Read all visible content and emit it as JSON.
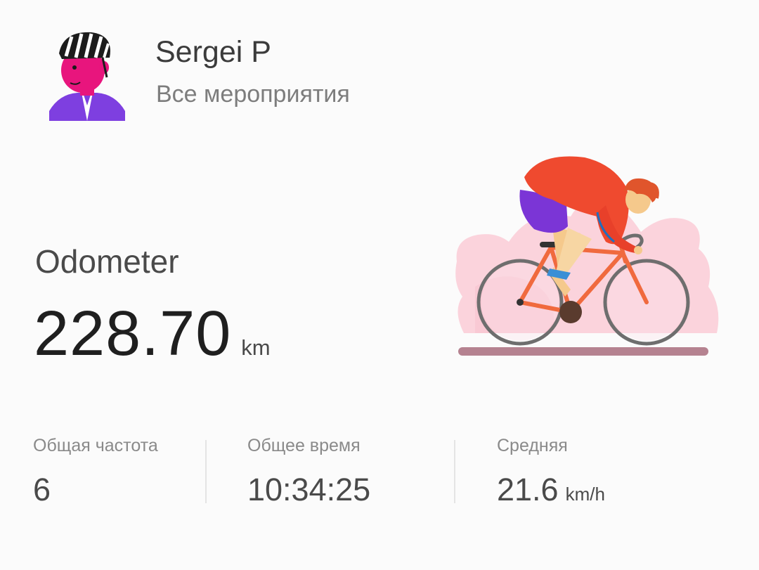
{
  "profile": {
    "name": "Sergei P",
    "subtitle": "Все мероприятия"
  },
  "odometer": {
    "label": "Odometer",
    "value": "228.70",
    "unit": "km"
  },
  "stats": [
    {
      "label": "Общая частота",
      "value": "6",
      "unit": ""
    },
    {
      "label": "Общее время",
      "value": "10:34:25",
      "unit": ""
    },
    {
      "label": "Средняя",
      "value": "21.6",
      "unit": "km/h"
    }
  ],
  "icons": {
    "avatar": "cyclist-avatar-icon",
    "illustration": "cyclist-illustration"
  },
  "colors": {
    "avatar_face": "#e8157d",
    "avatar_shirt": "#7e3fe0",
    "jersey": "#ef4a2f",
    "shorts": "#7b35d6",
    "bike_frame": "#f06a3e",
    "background_blob": "#fbd3dc"
  }
}
